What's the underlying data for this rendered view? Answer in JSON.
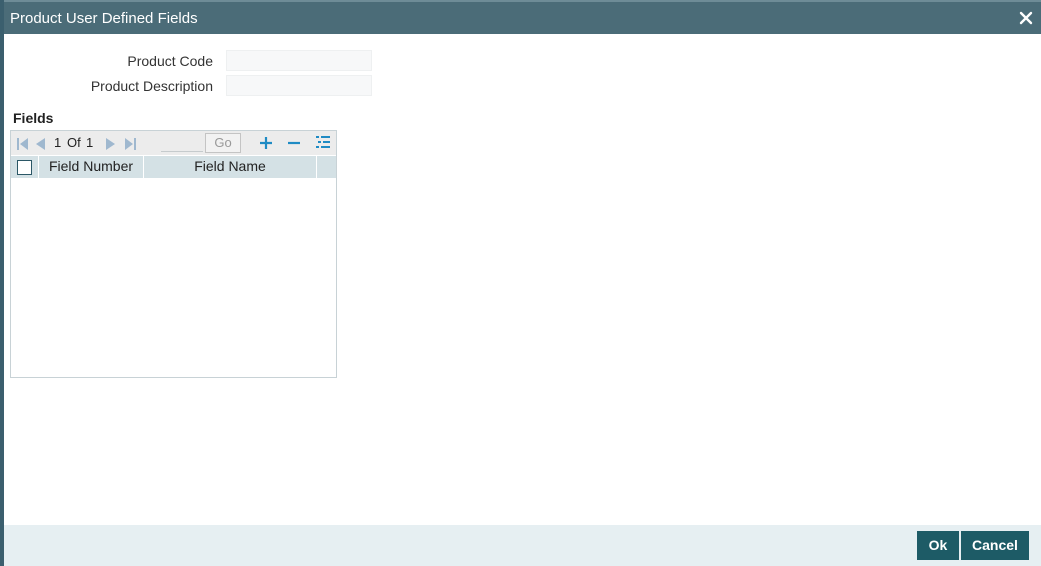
{
  "dialog": {
    "title": "Product User Defined Fields",
    "close_icon": "close-icon"
  },
  "form": {
    "product_code_label": "Product Code",
    "product_code_value": "",
    "product_description_label": "Product Description",
    "product_description_value": ""
  },
  "fields_section": {
    "title": "Fields",
    "pagination": {
      "current_page": "1",
      "of_label": "Of",
      "total_pages": "1",
      "go_label": "Go"
    },
    "columns": [
      "Field Number",
      "Field Name"
    ],
    "rows": []
  },
  "footer": {
    "ok_label": "Ok",
    "cancel_label": "Cancel"
  },
  "colors": {
    "title_bar": "#4b6c78",
    "primary_button": "#1d5b66",
    "grid_header": "#d4e1e5",
    "toolbar_icon_blue": "#1f8bc4"
  }
}
